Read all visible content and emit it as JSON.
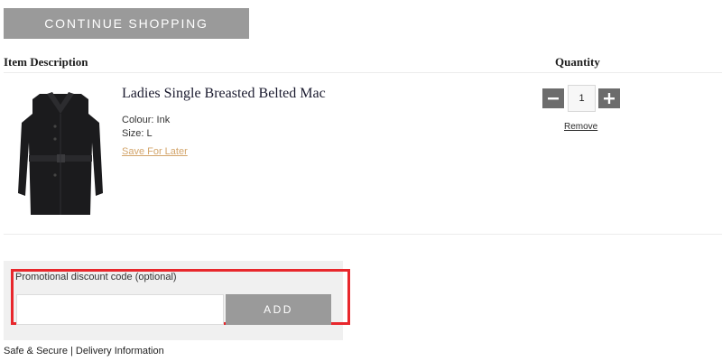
{
  "header": {
    "continue_label": "CONTINUE SHOPPING"
  },
  "table": {
    "col_description": "Item Description",
    "col_quantity": "Quantity"
  },
  "item": {
    "title": "Ladies Single Breasted Belted Mac",
    "colour": "Colour: Ink",
    "size": "Size: L",
    "save_for_later": "Save For Later",
    "quantity": "1",
    "remove": "Remove",
    "image_icon": "coat-image"
  },
  "promo": {
    "label": "Promotional discount code (optional)",
    "value": "",
    "add_label": "ADD"
  },
  "footer": {
    "safe_secure": "Safe & Secure",
    "separator": "|",
    "delivery": "Delivery Information"
  },
  "colors": {
    "button_gray": "#9a9a9a",
    "link_gold": "#d3a56b",
    "highlight_red": "#e8272c"
  }
}
